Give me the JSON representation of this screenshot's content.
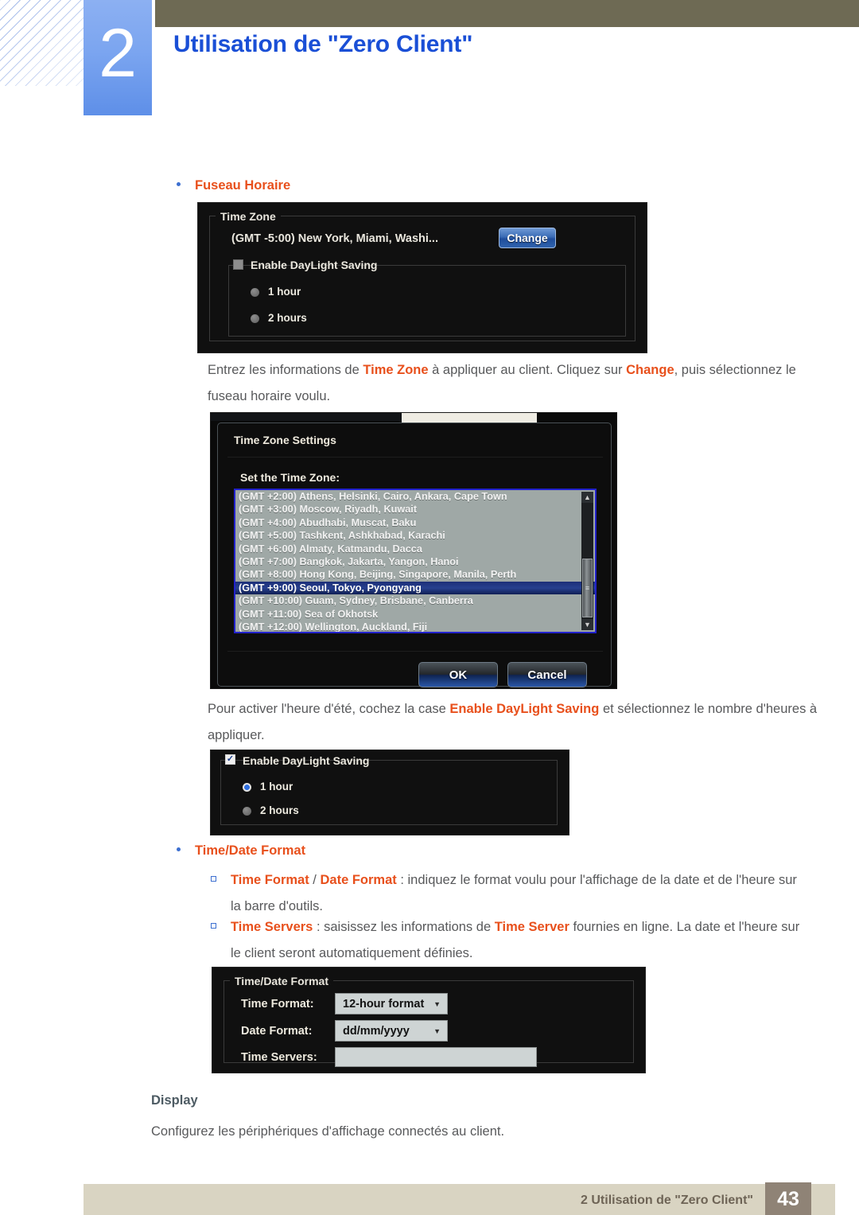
{
  "header": {
    "chapter_number": "2",
    "title": "Utilisation de \"Zero Client\"",
    "accent_blue": "#1a4fd6",
    "tab_blue": "#7ba5f0",
    "olive": "#6e6a54"
  },
  "sections": {
    "fuseau_horaire_label": "Fuseau Horaire",
    "time_date_format_label": "Time/Date Format",
    "display_label": "Display",
    "display_text": "Configurez les périphériques d'affichage connectés au client."
  },
  "paragraphs": {
    "p1_a": "Entrez les informations de ",
    "p1_b": "Time Zone",
    "p1_c": " à appliquer au client. Cliquez sur ",
    "p1_d": "Change",
    "p1_e": ", puis sélectionnez le fuseau horaire voulu.",
    "p2_a": "Pour activer l'heure d'été, cochez la case ",
    "p2_b": "Enable DayLight Saving",
    "p2_c": " et sélectionnez le nombre d'heures à appliquer.",
    "b1_a": "Time Format",
    "b1_sep": " / ",
    "b1_b": "Date Format",
    "b1_c": " : indiquez le format voulu pour l'affichage de la date et de l'heure sur la barre d'outils.",
    "b2_a": "Time Servers",
    "b2_b": " : saisissez les informations de ",
    "b2_c": "Time Server",
    "b2_d": " fournies en ligne. La date et l'heure sur le client seront automatiquement définies."
  },
  "shot_timezone": {
    "group_legend": "Time Zone",
    "value": "(GMT -5:00) New York, Miami, Washi...",
    "change_button": "Change",
    "dst_checkbox_label": "Enable DayLight Saving",
    "dst_checked": false,
    "radio_1": "1 hour",
    "radio_2": "2 hours",
    "radio_selected": ""
  },
  "shot_timezone_settings": {
    "dialog_title": "Time Zone Settings",
    "sub_label": "Set the Time Zone:",
    "selected_index": 7,
    "items": [
      "(GMT +2:00) Athens, Helsinki, Cairo, Ankara, Cape Town",
      "(GMT +3:00) Moscow, Riyadh, Kuwait",
      "(GMT +4:00) Abudhabi, Muscat, Baku",
      "(GMT +5:00) Tashkent, Ashkhabad, Karachi",
      "(GMT +6:00) Almaty, Katmandu, Dacca",
      "(GMT +7:00) Bangkok, Jakarta, Yangon, Hanoi",
      "(GMT +8:00) Hong Kong, Beijing, Singapore, Manila, Perth",
      "(GMT +9:00) Seoul, Tokyo, Pyongyang",
      "(GMT +10:00) Guam, Sydney, Brisbane, Canberra",
      "(GMT +11:00) Sea of Okhotsk",
      "(GMT +12:00) Wellington, Auckland, Fiji"
    ],
    "ok_button": "OK",
    "cancel_button": "Cancel",
    "scroll_up_glyph": "▲",
    "scroll_down_glyph": "▼",
    "thumb_grip_glyph": "≡"
  },
  "shot_daylight": {
    "dst_checkbox_label": "Enable DayLight Saving",
    "dst_checked": true,
    "check_glyph": "✓",
    "radio_1": "1 hour",
    "radio_2": "2 hours",
    "radio_selected": "1 hour"
  },
  "shot_time_date_format": {
    "group_legend": "Time/Date Format",
    "time_format_label": "Time Format:",
    "time_format_value": "12-hour format",
    "date_format_label": "Date Format:",
    "date_format_value": "dd/mm/yyyy",
    "time_servers_label": "Time Servers:",
    "time_servers_value": "",
    "caret_glyph": "▼"
  },
  "footer": {
    "text": "2 Utilisation de \"Zero Client\"",
    "page_number": "43",
    "bar_color": "#d9d4c2",
    "page_box_color": "#8f8376"
  }
}
